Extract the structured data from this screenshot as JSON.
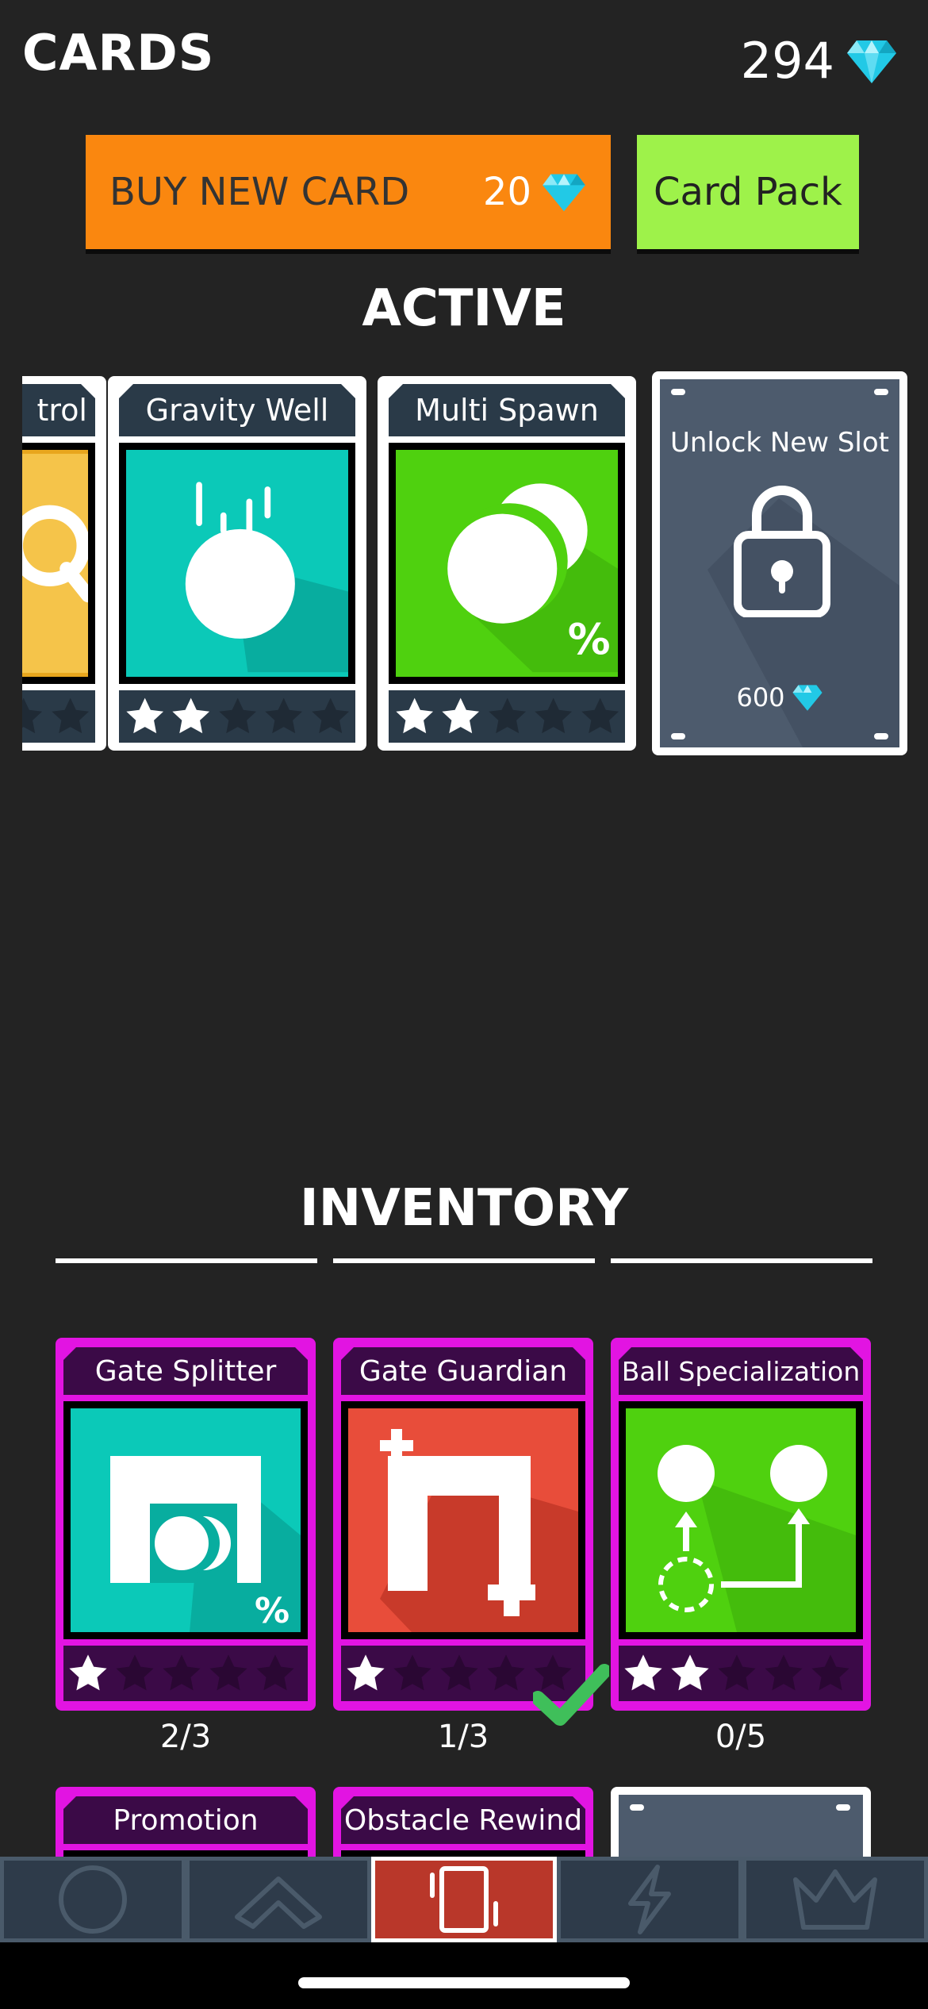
{
  "header": {
    "title": "CARDS",
    "gem_count": "294"
  },
  "actions": {
    "buy_label": "BUY NEW CARD",
    "buy_price": "20",
    "pack_label": "Card Pack"
  },
  "active": {
    "title": "ACTIVE",
    "cards": [
      {
        "name": "trol",
        "art_color": "#e8a61d",
        "stars": 0,
        "max_stars": 5
      },
      {
        "name": "Gravity Well",
        "art_color": "#0bc9b8",
        "stars": 2,
        "max_stars": 5
      },
      {
        "name": "Multi Spawn",
        "art_color": "#4fd10f",
        "stars": 2,
        "max_stars": 5
      }
    ],
    "locked_slot": {
      "label": "Unlock New Slot",
      "price": "600"
    }
  },
  "inventory": {
    "title": "INVENTORY",
    "cards": [
      {
        "name": "Gate Splitter",
        "art_color": "#0bc9b8",
        "stars": 1,
        "max_stars": 5,
        "count": "2/3"
      },
      {
        "name": "Gate Guardian",
        "art_color": "#e84d3a",
        "stars": 1,
        "max_stars": 5,
        "count": "1/3",
        "selected": true
      },
      {
        "name": "Ball Specialization",
        "art_color": "#4fd10f",
        "stars": 2,
        "max_stars": 5,
        "count": "0/5"
      },
      {
        "name": "Promotion"
      },
      {
        "name": "Obstacle Rewind"
      }
    ]
  },
  "nav": {
    "tabs": [
      {
        "icon": "circle-icon"
      },
      {
        "icon": "chevron-up-icon"
      },
      {
        "icon": "cards-icon",
        "active": true
      },
      {
        "icon": "lightning-icon"
      },
      {
        "icon": "crown-icon"
      }
    ]
  },
  "colors": {
    "accent_orange": "#fa870f",
    "accent_green": "#9ef24a",
    "gem": "#22c9e6",
    "inventory_frame": "#e214e2"
  }
}
